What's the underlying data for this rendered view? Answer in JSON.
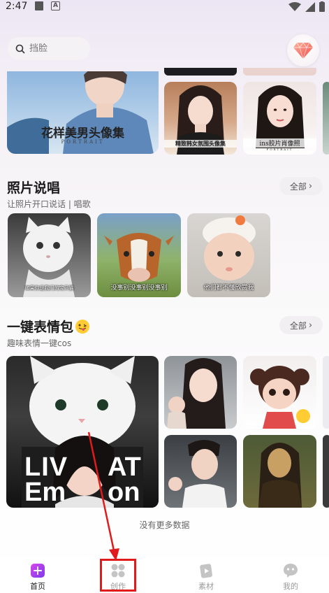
{
  "status_bar": {
    "time": "2:47"
  },
  "search": {
    "placeholder": "挡脸"
  },
  "top_cards": {
    "featured_title": "花样美男头像集",
    "featured_subtitle": "PORTRAIT",
    "card2_title": "精致韩女氛围头像集",
    "card2_subtitle": "PORTRAIT",
    "card3_title": "ins胶片肖像照",
    "card3_subtitle": "PORTRAIT"
  },
  "section_photo_sing": {
    "title": "照片说唱",
    "subtitle": "让照片开口说话 | 唱歌",
    "all_label": "全部",
    "items": [
      {
        "caption": "如果你是我们的宝贝猫"
      },
      {
        "caption": "没事别没事别没事别"
      },
      {
        "caption": "他们都不懂欣赏我"
      }
    ]
  },
  "section_emoji": {
    "title": "一键表情包",
    "subtitle": "趣味表情一键cos",
    "all_label": "全部",
    "featured_overlay": [
      "LIV",
      "AT",
      "Em",
      "on"
    ]
  },
  "footer": {
    "no_more": "没有更多数据"
  },
  "tabbar": {
    "tabs": [
      {
        "label": "首页",
        "icon": "home-icon",
        "active": true
      },
      {
        "label": "创作",
        "icon": "create-icon",
        "active": false
      },
      {
        "label": "素材",
        "icon": "material-icon",
        "active": false
      },
      {
        "label": "我的",
        "icon": "profile-icon",
        "active": false
      }
    ]
  },
  "colors": {
    "accent": "#8b5cf6",
    "annotation": "#e11b1b"
  }
}
